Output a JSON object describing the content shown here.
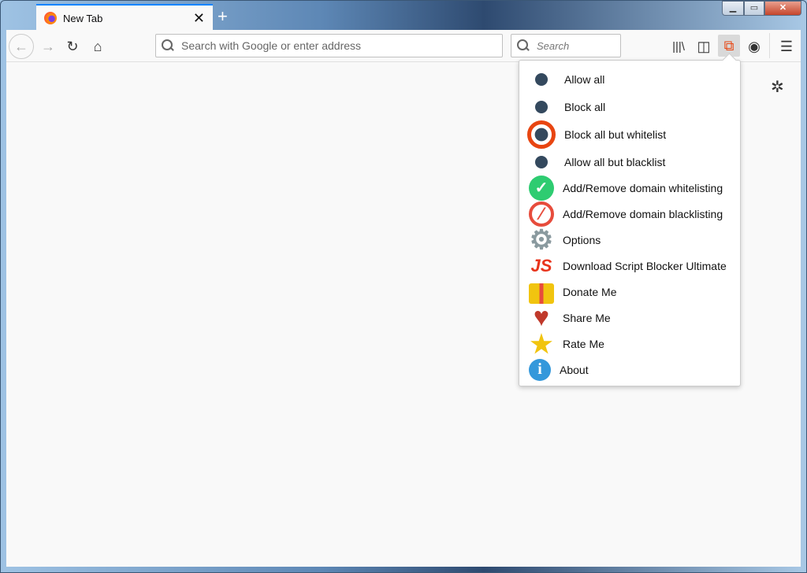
{
  "tab": {
    "title": "New Tab"
  },
  "toolbar": {
    "url_placeholder": "Search with Google or enter address",
    "search_placeholder": "Search"
  },
  "popup": {
    "radio_items": [
      {
        "label": "Allow all",
        "selected": false
      },
      {
        "label": "Block all",
        "selected": false
      },
      {
        "label": "Block all but whitelist",
        "selected": true
      },
      {
        "label": "Allow all but blacklist",
        "selected": false
      }
    ],
    "action_items": [
      {
        "label": "Add/Remove domain whitelisting",
        "icon": "check-circle-icon"
      },
      {
        "label": "Add/Remove domain blacklisting",
        "icon": "block-icon"
      },
      {
        "label": "Options",
        "icon": "gear-icon"
      },
      {
        "label": "Download Script Blocker Ultimate",
        "icon": "js-icon"
      },
      {
        "label": "Donate Me",
        "icon": "gift-icon"
      },
      {
        "label": "Share Me",
        "icon": "heart-icon"
      },
      {
        "label": "Rate Me",
        "icon": "star-icon"
      },
      {
        "label": "About",
        "icon": "info-icon"
      }
    ],
    "colors": {
      "selected_ring": "#e84511",
      "dot": "#34495e"
    }
  }
}
